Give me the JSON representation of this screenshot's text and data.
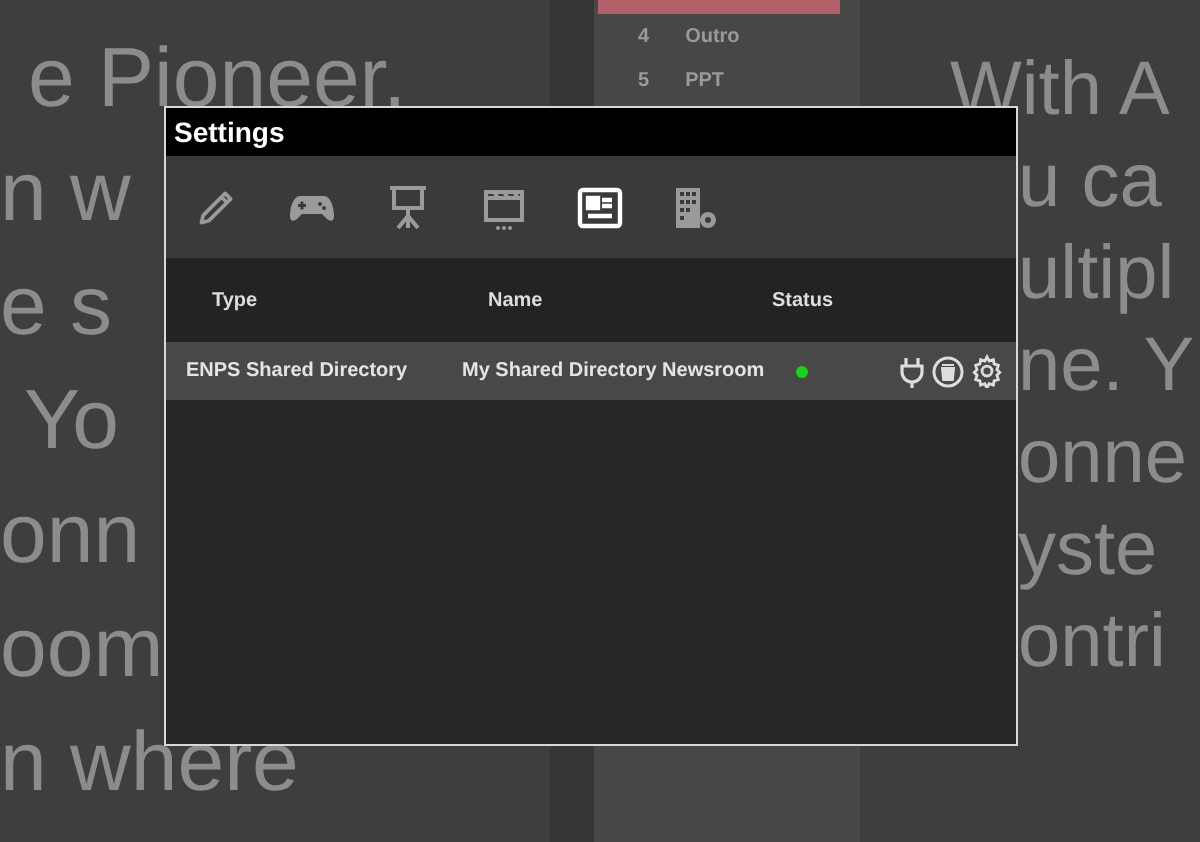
{
  "background": {
    "left_text": [
      "e Pioneer.",
      "n w",
      "e s",
      "Yo",
      "onn",
      "oom",
      "n where"
    ],
    "playlist": {
      "rows": [
        {
          "number": "4",
          "title": "Outro"
        },
        {
          "number": "5",
          "title": "PPT"
        }
      ]
    },
    "right_text": [
      "With A",
      "u ca",
      "ultipl",
      "ne. Y",
      "onne",
      "yste",
      "ontri"
    ]
  },
  "dialog": {
    "title": "Settings",
    "tabs": [
      {
        "kind": "pencil",
        "selected": false
      },
      {
        "kind": "gamepad",
        "selected": false
      },
      {
        "kind": "presentation",
        "selected": false
      },
      {
        "kind": "clapperboard",
        "selected": false
      },
      {
        "kind": "newspaper",
        "selected": true
      },
      {
        "kind": "building",
        "selected": false
      }
    ],
    "table": {
      "columns": [
        "Type",
        "Name",
        "Status"
      ],
      "rows": [
        {
          "type": "ENPS Shared Directory",
          "name": "My Shared Directory Newsroom",
          "online": true,
          "selected": true
        }
      ]
    }
  }
}
